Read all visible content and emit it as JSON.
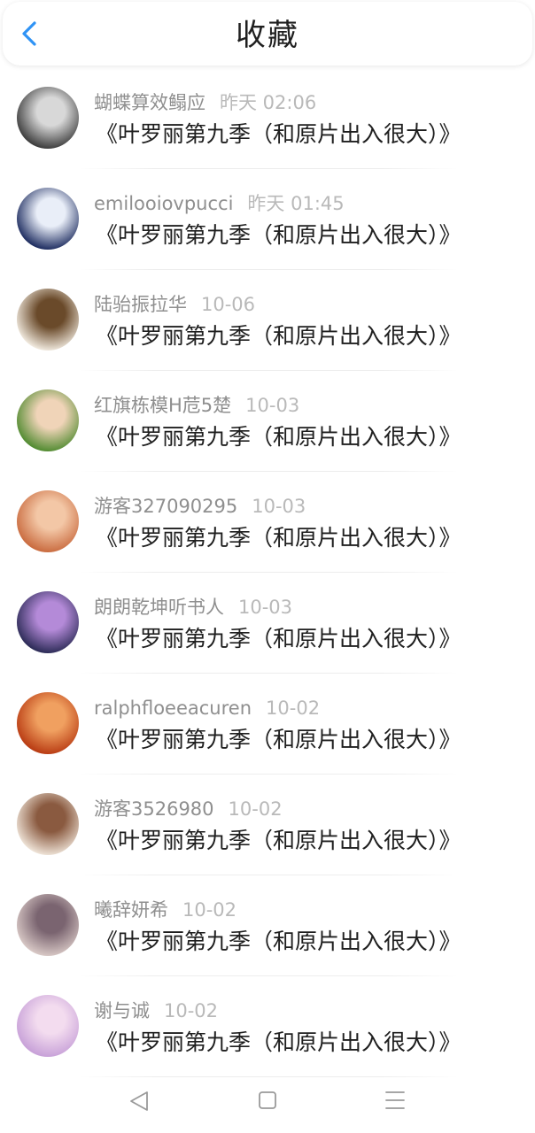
{
  "header": {
    "title": "收藏",
    "back_icon": "chevron-left-icon",
    "accent": "#2f93f5"
  },
  "favorites": [
    {
      "author": "蝴蝶算效鳎应",
      "time": "昨天 02:06",
      "book": "《叶罗丽第九季（和原片出入很大）》",
      "avatar_colors": [
        "#3a3a3a",
        "#d8d8d8"
      ]
    },
    {
      "author": "emilooiovpucci",
      "time": "昨天 01:45",
      "book": "《叶罗丽第九季（和原片出入很大）》",
      "avatar_colors": [
        "#1b2a5e",
        "#e9eef8"
      ]
    },
    {
      "author": "陆骀振拉华",
      "time": "10-06",
      "book": "《叶罗丽第九季（和原片出入很大）》",
      "avatar_colors": [
        "#f2ebe0",
        "#6a4a2a"
      ]
    },
    {
      "author": "红旗栋模H苊5楚",
      "time": "10-03",
      "book": "《叶罗丽第九季（和原片出入很大）》",
      "avatar_colors": [
        "#4f8a2f",
        "#f0d4b8"
      ]
    },
    {
      "author": "游客327090295",
      "time": "10-03",
      "book": "《叶罗丽第九季（和原片出入很大）》",
      "avatar_colors": [
        "#c96a3e",
        "#f3c7a6"
      ]
    },
    {
      "author": "朗朗乾坤听书人",
      "time": "10-03",
      "book": "《叶罗丽第九季（和原片出入很大）》",
      "avatar_colors": [
        "#2a2a55",
        "#b48ad8"
      ]
    },
    {
      "author": "ralphfloeeacuren",
      "time": "10-02",
      "book": "《叶罗丽第九季（和原片出入很大）》",
      "avatar_colors": [
        "#b83a12",
        "#f0a060"
      ]
    },
    {
      "author": "游客3526980",
      "time": "10-02",
      "book": "《叶罗丽第九季（和原片出入很大）》",
      "avatar_colors": [
        "#efe4d8",
        "#8a5a40"
      ]
    },
    {
      "author": "曦辞妍希",
      "time": "10-02",
      "book": "《叶罗丽第九季（和原片出入很大）》",
      "avatar_colors": [
        "#d9c9c6",
        "#7a6470"
      ]
    },
    {
      "author": "谢与诚",
      "time": "10-02",
      "book": "《叶罗丽第九季（和原片出入很大）》",
      "avatar_colors": [
        "#c7a0d8",
        "#f3dcef"
      ]
    }
  ],
  "system_nav": {
    "back_icon": "triangle-back-icon",
    "home_icon": "square-home-icon",
    "menu_icon": "menu-lines-icon"
  }
}
